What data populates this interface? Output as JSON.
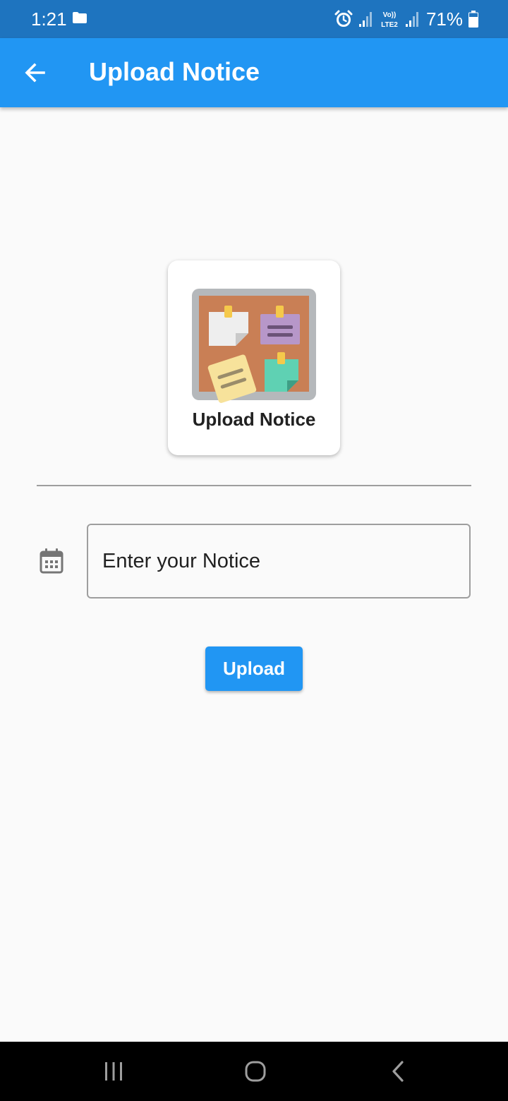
{
  "status_bar": {
    "time": "1:21",
    "battery_percent": "71%",
    "icons": [
      "folder-icon",
      "alarm-icon",
      "signal-icon",
      "volte-lte2-icon",
      "signal-icon",
      "battery-icon"
    ]
  },
  "app_bar": {
    "title": "Upload Notice",
    "back_icon": "arrow-left-icon"
  },
  "card": {
    "label": "Upload Notice",
    "icon": "notice-board-icon"
  },
  "notice_field": {
    "placeholder": "Enter your Notice",
    "value": "",
    "icon": "calendar-icon"
  },
  "upload_button": {
    "label": "Upload"
  },
  "nav_bar": {
    "buttons": [
      "recent-apps-icon",
      "home-icon",
      "back-icon"
    ]
  },
  "colors": {
    "status_bar": "#1e74bf",
    "app_bar": "#2196f3",
    "accent": "#2196f3",
    "background": "#fafafa"
  }
}
